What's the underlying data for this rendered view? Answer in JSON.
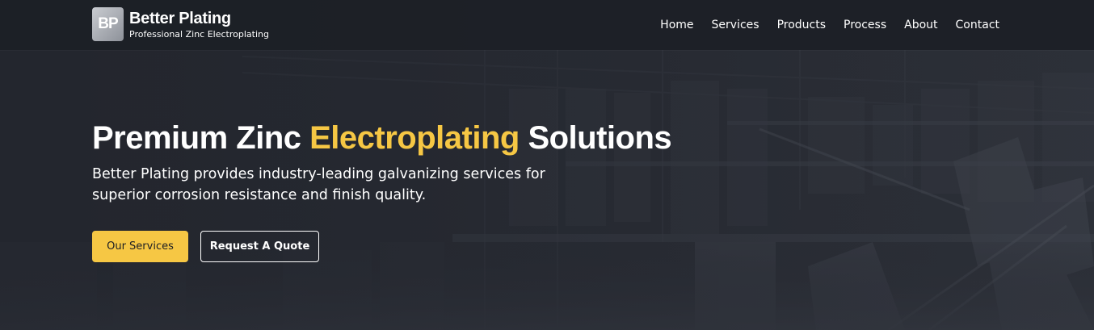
{
  "brand": {
    "logo_initials": "BP",
    "name": "Better Plating",
    "tagline": "Professional Zinc Electroplating"
  },
  "nav": {
    "items": [
      {
        "label": "Home"
      },
      {
        "label": "Services"
      },
      {
        "label": "Products"
      },
      {
        "label": "Process"
      },
      {
        "label": "About"
      },
      {
        "label": "Contact"
      }
    ]
  },
  "hero": {
    "title_pre": "Premium Zinc ",
    "title_accent": "Electroplating",
    "title_post": " Solutions",
    "subtitle": "Better Plating provides industry-leading galvanizing services for superior corrosion resistance and finish quality.",
    "primary_cta": "Our Services",
    "secondary_cta": "Request A Quote"
  },
  "colors": {
    "accent": "#f6c744",
    "header_bg": "#1c1f26",
    "hero_bg": "#262931",
    "text": "#ffffff"
  }
}
